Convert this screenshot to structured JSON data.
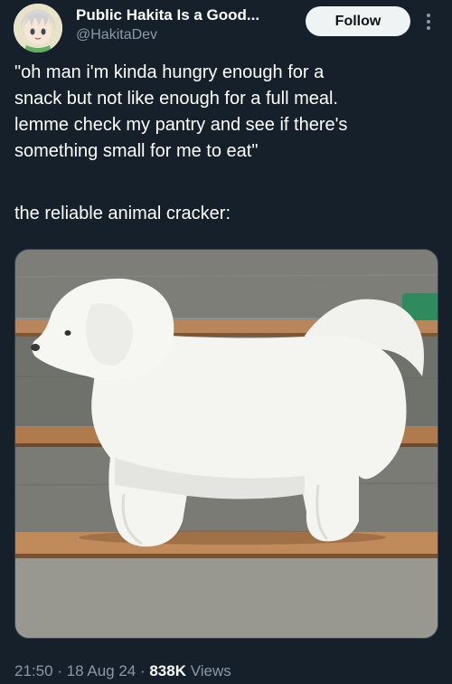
{
  "author": {
    "display_name": "Public Hakita Is a Good...",
    "handle": "@HakitaDev",
    "avatar_icon": "anime-avatar"
  },
  "follow_label": "Follow",
  "more_icon": "more-vertical-icon",
  "tweet": {
    "quote_lines": [
      "\"oh man i'm kinda hungry enough for a",
      "snack but not like enough for a full meal.",
      "lemme check my pantry and see if there's",
      "something small for me to eat\""
    ],
    "caption": "the reliable animal cracker:"
  },
  "meta": {
    "time": "21:50",
    "sep1": " · ",
    "date": "18 Aug 24",
    "sep2": " · ",
    "views_count": "838K",
    "views_label": " Views"
  },
  "colors": {
    "background": "#15202b",
    "text": "#ffffff",
    "secondary": "#8b98a5",
    "follow_bg": "#eff3f4"
  }
}
